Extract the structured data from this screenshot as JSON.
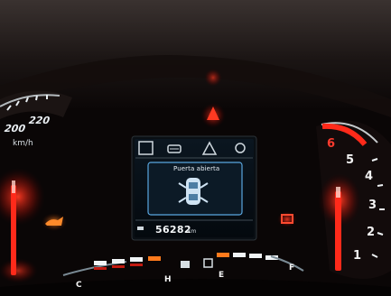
{
  "speedometer": {
    "ticks": [
      "220",
      "200"
    ],
    "unit": "km/h"
  },
  "tachometer": {
    "ticks": [
      "6",
      "5",
      "4",
      "3",
      "2",
      "1"
    ],
    "redline_ticks": [
      "6"
    ]
  },
  "display": {
    "message": "Puerta abierta",
    "odometer": "56282",
    "odometer_unit": "km",
    "top_icons": [
      "display-mode-icon",
      "car-front-icon",
      "warning-triangle-icon",
      "settings-icon"
    ]
  },
  "fuel_gauge": {
    "empty_label": "E",
    "full_label": "F"
  },
  "temp_gauge": {
    "cold_label": "C",
    "hot_label": "H"
  },
  "warning_lights": [
    "oil-pressure-icon",
    "battery-icon",
    "master-warning-icon"
  ],
  "colors": {
    "needle_red": "#ff2a1a",
    "screen_blue": "#5aa7e0",
    "amber": "#ff7a1c"
  }
}
